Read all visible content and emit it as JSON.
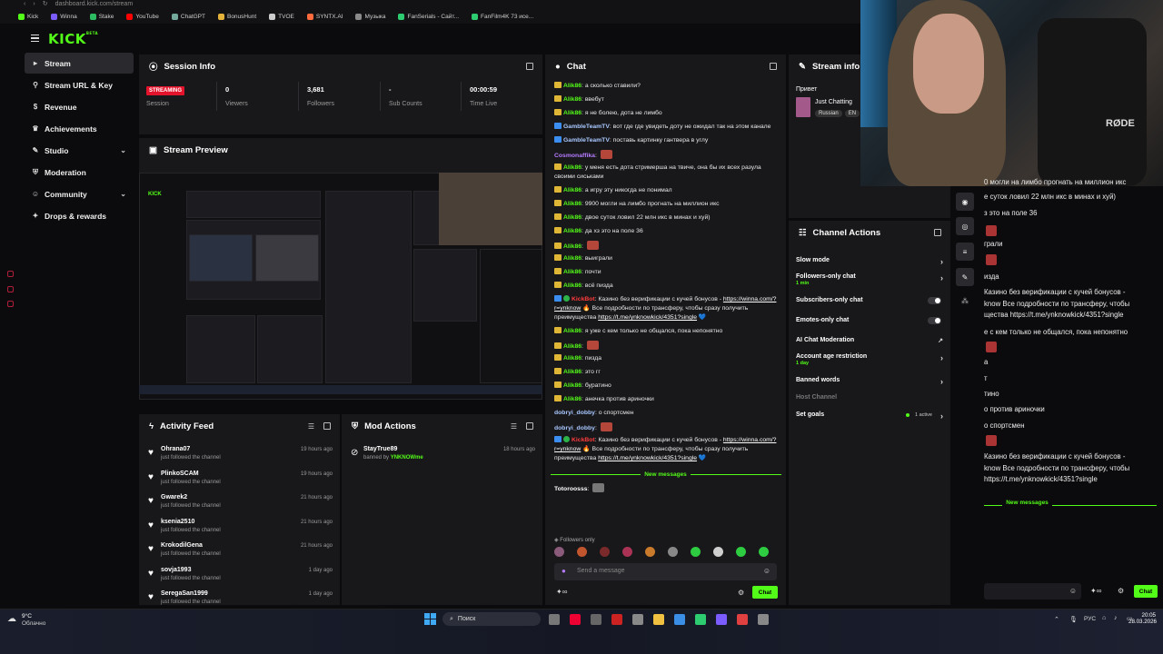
{
  "browser": {
    "url": "dashboard.kick.com/stream",
    "bookmarks": [
      "Kick",
      "Winna",
      "Stake",
      "YouTube",
      "ChatGPT",
      "BonusHunt",
      "TVOE",
      "SYNTX.AI",
      "Музыка",
      "FanSerials - Сайт...",
      "FanFilm4K 73 исе..."
    ]
  },
  "nav": {
    "logo": "KICK",
    "logo_sup": "BETA",
    "items": [
      {
        "label": "Stream",
        "icon": "stream-icon"
      },
      {
        "label": "Stream URL & Key",
        "icon": "link-icon"
      },
      {
        "label": "Revenue",
        "icon": "dollar-icon"
      },
      {
        "label": "Achievements",
        "icon": "trophy-icon"
      },
      {
        "label": "Studio",
        "icon": "brush-icon"
      },
      {
        "label": "Moderation",
        "icon": "shield-icon"
      },
      {
        "label": "Community",
        "icon": "users-icon"
      },
      {
        "label": "Drops & rewards",
        "icon": "gift-icon"
      }
    ]
  },
  "session": {
    "title": "Session Info",
    "live_badge": "STREAMING",
    "stats": [
      {
        "value": "",
        "label": "Session"
      },
      {
        "value": "0",
        "label": "Viewers"
      },
      {
        "value": "3,681",
        "label": "Followers"
      },
      {
        "value": "-",
        "label": "Sub Counts"
      },
      {
        "value": "00:00:59",
        "label": "Time Live"
      }
    ]
  },
  "preview": {
    "title": "Stream Preview"
  },
  "activity": {
    "title": "Activity Feed",
    "items": [
      {
        "name": "Ohrana07",
        "sub": "just followed the channel",
        "time": "19 hours ago"
      },
      {
        "name": "PlinkoSCAM",
        "sub": "just followed the channel",
        "time": "19 hours ago"
      },
      {
        "name": "Gwarek2",
        "sub": "just followed the channel",
        "time": "21 hours ago"
      },
      {
        "name": "ksenia2510",
        "sub": "just followed the channel",
        "time": "21 hours ago"
      },
      {
        "name": "KrokodilGena",
        "sub": "just followed the channel",
        "time": "21 hours ago"
      },
      {
        "name": "sovja1993",
        "sub": "just followed the channel",
        "time": "1 day ago"
      },
      {
        "name": "SeregaSan1999",
        "sub": "just followed the channel",
        "time": "1 day ago"
      }
    ]
  },
  "mod_actions": {
    "title": "Mod Actions",
    "items": [
      {
        "name": "StayTrue89",
        "by_prefix": "banned by",
        "by": "YNKNOWme",
        "time": "18 hours ago"
      }
    ]
  },
  "chat": {
    "title": "Chat",
    "lines": [
      {
        "user": "Alik86",
        "text": "а сколько ставили?"
      },
      {
        "user": "Alik86",
        "text": "ввебут"
      },
      {
        "user": "Alik86",
        "text": "я не болею, дота не лимбо"
      },
      {
        "user": "GambleTeamTV",
        "text": "вот где где увидеть доту не ожидал так на этом канале"
      },
      {
        "user": "GambleTeamTV",
        "text": "поставь картинку гантвера в углу"
      },
      {
        "user": "Cosmonaffika",
        "text": ""
      },
      {
        "user": "Alik86",
        "text": "у меня есть дота стримерша на твиче, она бы их всех разула своими сиськами"
      },
      {
        "user": "Alik86",
        "text": "а игру эту никогда не понимал"
      },
      {
        "user": "Alik86",
        "text": "9900 могли на лимбо прогнать на миллион икс"
      },
      {
        "user": "Alik86",
        "text": "двое суток ловил 22 млн икс в минах и хуй)"
      },
      {
        "user": "Alik86",
        "text": "да хз это на поле 36"
      },
      {
        "user": "Alik86",
        "text": ""
      },
      {
        "user": "Alik86",
        "text": "выиграли"
      },
      {
        "user": "Alik86",
        "text": "почти"
      },
      {
        "user": "Alik86",
        "text": "всё пизда"
      },
      {
        "user": "KickBot",
        "text": "Казино без верификации с кучей бонусов -",
        "link1": "https://winna.com/?r=ynknow",
        "mid": "Все подробности по трансферу, чтобы сразу получить преимущества",
        "link2": "https://t.me/ynknowkick/4351?single"
      },
      {
        "user": "Alik86",
        "text": "я уже с кем только не общался, пока непонятно"
      },
      {
        "user": "Alik86",
        "text": ""
      },
      {
        "user": "Alik86",
        "text": "пизда"
      },
      {
        "user": "Alik86",
        "text": "это гг"
      },
      {
        "user": "Alik86",
        "text": "буратино"
      },
      {
        "user": "Alik86",
        "text": "анечка против ариночки"
      },
      {
        "user": "dobryi_dobby",
        "text": "о спортсмен"
      },
      {
        "user": "dobryi_dobby",
        "text": ""
      },
      {
        "user": "KickBot",
        "text": "Казино без верификации с кучей бонусов -",
        "link1": "https://winna.com/?r=ynknow",
        "mid": "Все подробности по трансферу, чтобы сразу получить преимущества",
        "link2": "https://t.me/ynknowkick/4351?single"
      }
    ],
    "new_messages": "New messages",
    "last_user": "Totoroosss",
    "followers_only": "Followers only",
    "input_placeholder": "Send a message",
    "send_label": "Chat"
  },
  "stream_info": {
    "title": "Stream info",
    "stream_title": "Привет",
    "category": "Just Chatting",
    "tags": [
      "Russian",
      "EN"
    ]
  },
  "channel_actions": {
    "title": "Channel Actions",
    "items": [
      {
        "label": "Slow mode",
        "sub": "",
        "control": "chevron"
      },
      {
        "label": "Followers-only chat",
        "sub": "1 min",
        "control": "chevron"
      },
      {
        "label": "Subscribers-only chat",
        "sub": "",
        "control": "toggle"
      },
      {
        "label": "Emotes-only chat",
        "sub": "",
        "control": "toggle"
      },
      {
        "label": "AI Chat Moderation",
        "sub": "",
        "control": "external"
      },
      {
        "label": "Account age restriction",
        "sub": "1 day",
        "control": "chevron"
      },
      {
        "label": "Banned words",
        "sub": "",
        "control": "chevron"
      },
      {
        "label": "Host Channel",
        "sub": "",
        "control": "none"
      },
      {
        "label": "Set goals",
        "sub": "",
        "control": "chevron",
        "status": "1 active"
      }
    ]
  },
  "popout_chat": {
    "lines": [
      "0 могли на лимбо прогнать на миллион икс",
      "е суток ловил 22 млн икс в минах и хуй)",
      "з это на поле 36",
      "",
      "грали",
      "",
      "изда",
      "Казино без верификации с кучей бонусов -",
      "know  Все подробности по трансферу, чтобы",
      "щества https://t.me/ynknowkick/4351?single",
      "е с кем только не общался, пока непонятно",
      "",
      "а",
      "т",
      "тино",
      "о против ариночки",
      "о спортсмен",
      "",
      "Казино без верификации с кучей бонусов -",
      "know  Все подробности по трансферу, чтобы",
      "https://t.me/ynknowkick/4351?single"
    ],
    "new_messages": "New messages",
    "send_label": "Chat"
  },
  "taskbar": {
    "weather_temp": "9°C",
    "weather_text": "Облачно",
    "search": "Поиск",
    "lang": "РУС",
    "time": "20:05",
    "date": "28.03.2026"
  }
}
